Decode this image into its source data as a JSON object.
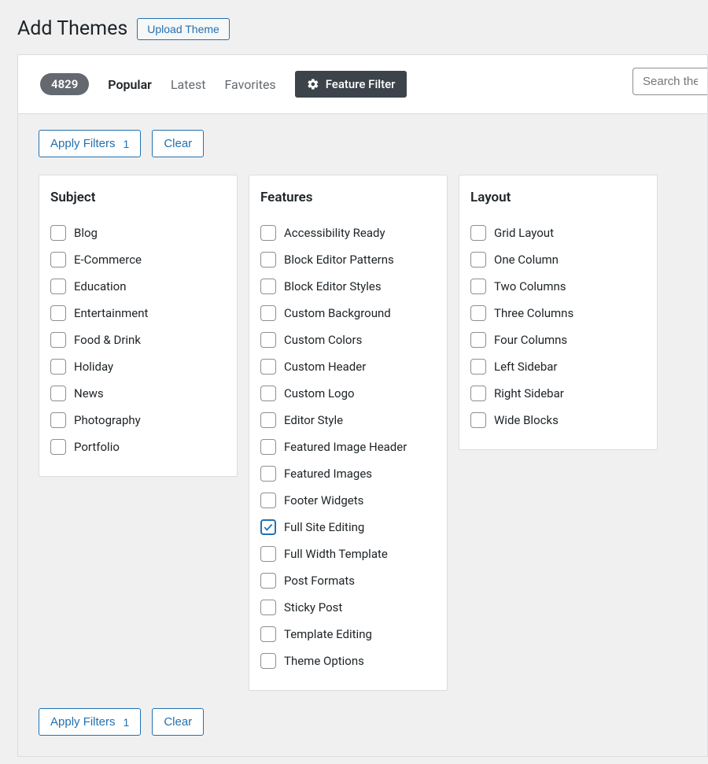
{
  "header": {
    "title": "Add Themes",
    "upload_label": "Upload Theme"
  },
  "tabs": {
    "count": "4829",
    "popular": "Popular",
    "latest": "Latest",
    "favorites": "Favorites",
    "feature_filter": "Feature Filter"
  },
  "search": {
    "placeholder": "Search them"
  },
  "actions": {
    "apply": "Apply Filters",
    "apply_count": "1",
    "clear": "Clear"
  },
  "columns": {
    "subject": {
      "title": "Subject",
      "items": [
        {
          "label": "Blog",
          "checked": false
        },
        {
          "label": "E-Commerce",
          "checked": false
        },
        {
          "label": "Education",
          "checked": false
        },
        {
          "label": "Entertainment",
          "checked": false
        },
        {
          "label": "Food & Drink",
          "checked": false
        },
        {
          "label": "Holiday",
          "checked": false
        },
        {
          "label": "News",
          "checked": false
        },
        {
          "label": "Photography",
          "checked": false
        },
        {
          "label": "Portfolio",
          "checked": false
        }
      ]
    },
    "features": {
      "title": "Features",
      "items": [
        {
          "label": "Accessibility Ready",
          "checked": false
        },
        {
          "label": "Block Editor Patterns",
          "checked": false
        },
        {
          "label": "Block Editor Styles",
          "checked": false
        },
        {
          "label": "Custom Background",
          "checked": false
        },
        {
          "label": "Custom Colors",
          "checked": false
        },
        {
          "label": "Custom Header",
          "checked": false
        },
        {
          "label": "Custom Logo",
          "checked": false
        },
        {
          "label": "Editor Style",
          "checked": false
        },
        {
          "label": "Featured Image Header",
          "checked": false
        },
        {
          "label": "Featured Images",
          "checked": false
        },
        {
          "label": "Footer Widgets",
          "checked": false
        },
        {
          "label": "Full Site Editing",
          "checked": true
        },
        {
          "label": "Full Width Template",
          "checked": false
        },
        {
          "label": "Post Formats",
          "checked": false
        },
        {
          "label": "Sticky Post",
          "checked": false
        },
        {
          "label": "Template Editing",
          "checked": false
        },
        {
          "label": "Theme Options",
          "checked": false
        }
      ]
    },
    "layout": {
      "title": "Layout",
      "items": [
        {
          "label": "Grid Layout",
          "checked": false
        },
        {
          "label": "One Column",
          "checked": false
        },
        {
          "label": "Two Columns",
          "checked": false
        },
        {
          "label": "Three Columns",
          "checked": false
        },
        {
          "label": "Four Columns",
          "checked": false
        },
        {
          "label": "Left Sidebar",
          "checked": false
        },
        {
          "label": "Right Sidebar",
          "checked": false
        },
        {
          "label": "Wide Blocks",
          "checked": false
        }
      ]
    }
  }
}
